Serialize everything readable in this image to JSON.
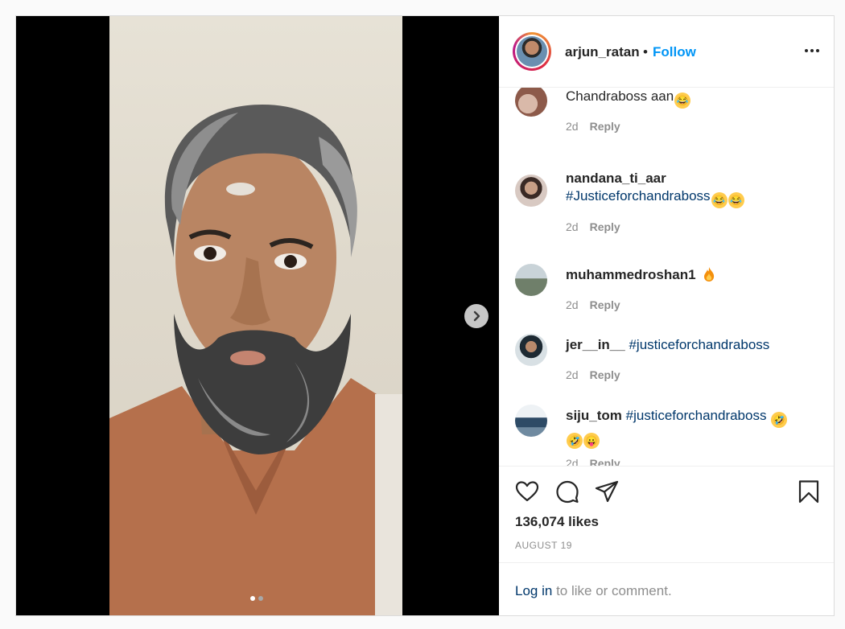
{
  "post": {
    "author": {
      "username": "arjun_ratan",
      "separator": "•",
      "follow_label": "Follow"
    },
    "carousel": {
      "total_slides": 2,
      "current_slide": 1
    },
    "comments": [
      {
        "username": "",
        "text": "Chandraboss aan",
        "emoji": [
          "joy"
        ],
        "age": "2d",
        "reply_label": "Reply"
      },
      {
        "username": "nandana_ti_aar",
        "text": "#Justiceforchandraboss",
        "emoji": [
          "joy",
          "joy"
        ],
        "age": "2d",
        "reply_label": "Reply"
      },
      {
        "username": "muhammedroshan1",
        "text": "",
        "emoji": [
          "fire"
        ],
        "age": "2d",
        "reply_label": "Reply"
      },
      {
        "username": "jer__in__",
        "text": "#justiceforchandraboss",
        "emoji": [],
        "age": "2d",
        "reply_label": "Reply"
      },
      {
        "username": "siju_tom",
        "text": "#justiceforchandraboss",
        "emoji": [
          "rofl",
          "rofl",
          "tongue"
        ],
        "age": "2d",
        "reply_label": "Reply"
      }
    ],
    "likes": "136,074 likes",
    "date": "AUGUST 19",
    "login": {
      "link": "Log in",
      "suffix": "to like or comment."
    }
  },
  "icons": {
    "like": "heart-icon",
    "comment": "comment-icon",
    "share": "paper-plane-icon",
    "save": "bookmark-icon",
    "more": "more-horizontal-icon",
    "next": "chevron-right-icon"
  },
  "colors": {
    "link_blue": "#0095f6",
    "hashtag": "#00376b",
    "muted": "#8e8e8e",
    "text": "#262626"
  }
}
